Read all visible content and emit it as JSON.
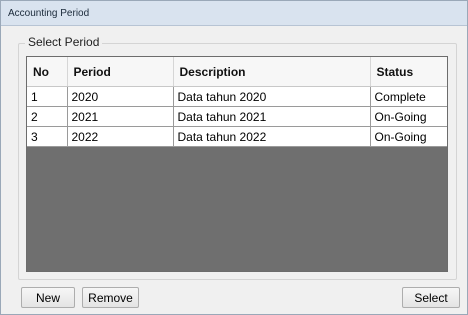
{
  "window": {
    "title": "Accounting Period"
  },
  "group": {
    "label": "Select Period"
  },
  "table": {
    "columns": [
      "No",
      "Period",
      "Description",
      "Status"
    ],
    "rows": [
      [
        "1",
        "2020",
        "Data tahun 2020",
        "Complete"
      ],
      [
        "2",
        "2021",
        "Data tahun 2021",
        "On-Going"
      ],
      [
        "3",
        "2022",
        "Data tahun 2022",
        "On-Going"
      ]
    ]
  },
  "buttons": {
    "new": "New",
    "remove": "Remove",
    "select": "Select"
  }
}
